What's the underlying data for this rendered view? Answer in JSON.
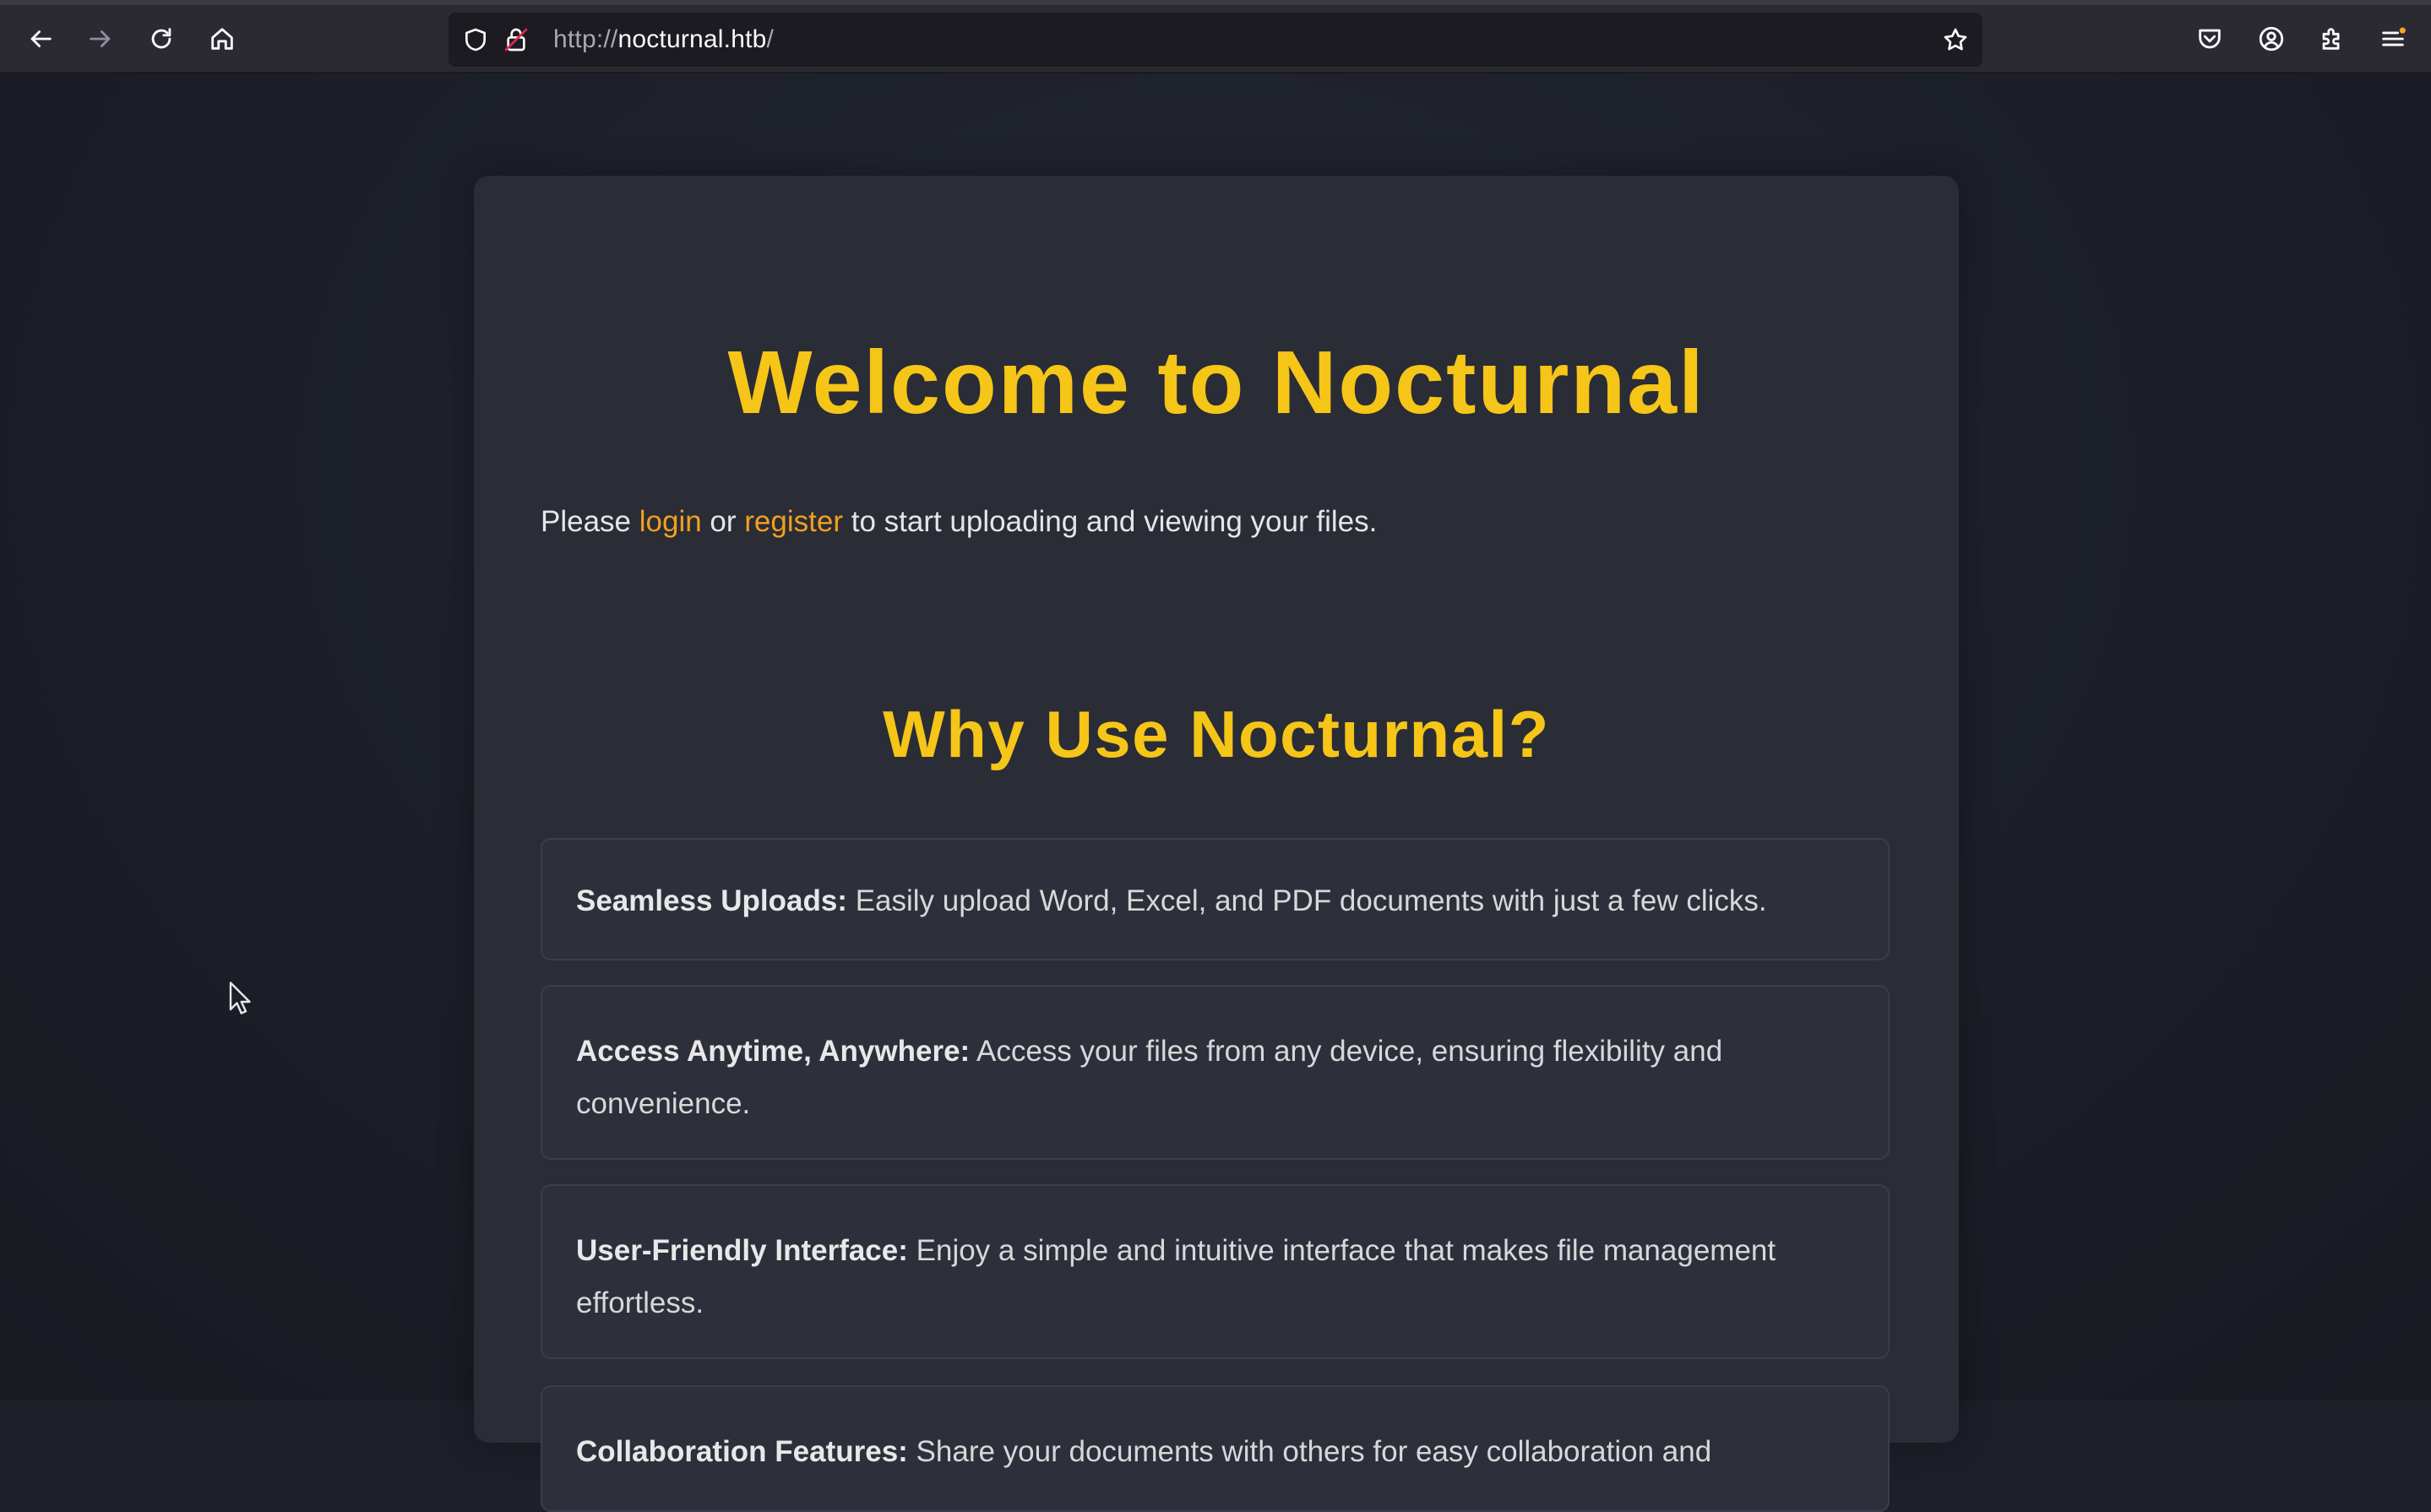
{
  "browser": {
    "url_protocol": "http://",
    "url_host": "nocturnal.htb",
    "url_path": "/",
    "icons": [
      "back-icon",
      "forward-icon",
      "reload-icon",
      "home-icon",
      "shield-icon",
      "lock-insecure-icon",
      "bookmark-star-icon",
      "pocket-icon",
      "account-icon",
      "extensions-icon",
      "menu-icon"
    ]
  },
  "page": {
    "title": "Welcome to Nocturnal",
    "intro_prefix": "Please ",
    "login_label": "login",
    "intro_or": " or ",
    "register_label": "register",
    "intro_suffix": " to start uploading and viewing your files.",
    "why_title": "Why Use Nocturnal?",
    "features": [
      {
        "title": "Seamless Uploads:",
        "text": " Easily upload Word, Excel, and PDF documents with just a few clicks."
      },
      {
        "title": "Access Anytime, Anywhere:",
        "text": " Access your files from any device, ensuring flexibility and convenience."
      },
      {
        "title": "User-Friendly Interface:",
        "text": " Enjoy a simple and intuitive interface that makes file management effortless."
      },
      {
        "title": "Collaboration Features:",
        "text": " Share your documents with others for easy collaboration and"
      }
    ]
  },
  "colors": {
    "accent_heading": "#f5c518",
    "link": "#f0a020",
    "card_bg": "#2a2c36",
    "page_bg": "#1d2029"
  }
}
